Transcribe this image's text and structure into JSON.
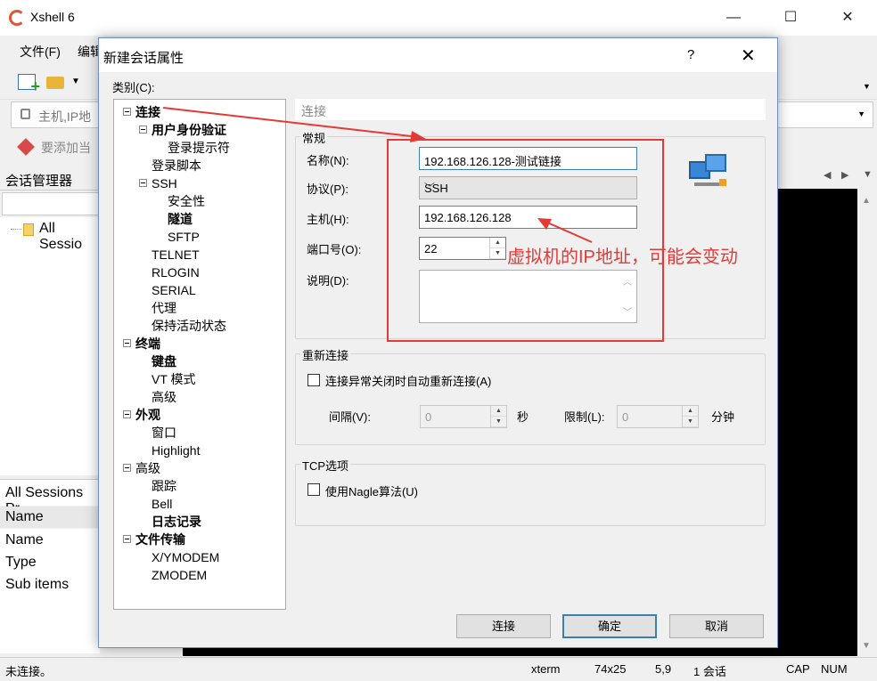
{
  "main_window": {
    "title": "Xshell 6",
    "controls": {
      "minimize": "—",
      "maximize": "☐",
      "close": "✕"
    },
    "menu": [
      "文件(F)",
      "编辑"
    ],
    "address_placeholder": "主机,IP地",
    "bookmark_text": "要添加当",
    "session_manager_title": "会话管理器",
    "session_tree_item": "All Sessio",
    "properties_header": "All Sessions Pr",
    "properties_column": "Name",
    "properties_rows": [
      "Name",
      "Type",
      "Sub items"
    ]
  },
  "statusbar": {
    "left": "未连接。",
    "term": "xterm",
    "size": "74x25",
    "cursor": "5,9",
    "sessions": "1 会话",
    "cap": "CAP",
    "num": "NUM"
  },
  "dialog": {
    "title": "新建会话属性",
    "help": "?",
    "close": "✕",
    "category_label": "类别(C):",
    "tree": [
      {
        "label": "连接",
        "level": 0,
        "bold": true,
        "expand": true
      },
      {
        "label": "用户身份验证",
        "level": 1,
        "bold": true,
        "expand": true
      },
      {
        "label": "登录提示符",
        "level": 2,
        "bold": false,
        "expand": false
      },
      {
        "label": "登录脚本",
        "level": 1,
        "bold": false,
        "expand": false
      },
      {
        "label": "SSH",
        "level": 1,
        "bold": false,
        "expand": true
      },
      {
        "label": "安全性",
        "level": 2,
        "bold": false,
        "expand": false
      },
      {
        "label": "隧道",
        "level": 2,
        "bold": true,
        "expand": false
      },
      {
        "label": "SFTP",
        "level": 2,
        "bold": false,
        "expand": false
      },
      {
        "label": "TELNET",
        "level": 1,
        "bold": false,
        "expand": false
      },
      {
        "label": "RLOGIN",
        "level": 1,
        "bold": false,
        "expand": false
      },
      {
        "label": "SERIAL",
        "level": 1,
        "bold": false,
        "expand": false
      },
      {
        "label": "代理",
        "level": 1,
        "bold": false,
        "expand": false
      },
      {
        "label": "保持活动状态",
        "level": 1,
        "bold": false,
        "expand": false
      },
      {
        "label": "终端",
        "level": 0,
        "bold": true,
        "expand": true
      },
      {
        "label": "键盘",
        "level": 1,
        "bold": true,
        "expand": false
      },
      {
        "label": "VT 模式",
        "level": 1,
        "bold": false,
        "expand": false
      },
      {
        "label": "高级",
        "level": 1,
        "bold": false,
        "expand": false
      },
      {
        "label": "外观",
        "level": 0,
        "bold": true,
        "expand": true
      },
      {
        "label": "窗口",
        "level": 1,
        "bold": false,
        "expand": false
      },
      {
        "label": "Highlight",
        "level": 1,
        "bold": false,
        "expand": false
      },
      {
        "label": "高级",
        "level": 0,
        "bold": false,
        "expand": true
      },
      {
        "label": "跟踪",
        "level": 1,
        "bold": false,
        "expand": false
      },
      {
        "label": "Bell",
        "level": 1,
        "bold": false,
        "expand": false
      },
      {
        "label": "日志记录",
        "level": 1,
        "bold": true,
        "expand": false
      },
      {
        "label": "文件传输",
        "level": 0,
        "bold": true,
        "expand": true
      },
      {
        "label": "X/YMODEM",
        "level": 1,
        "bold": false,
        "expand": false
      },
      {
        "label": "ZMODEM",
        "level": 1,
        "bold": false,
        "expand": false
      }
    ],
    "section_header": "连接",
    "general": {
      "title": "常规",
      "name_label": "名称(N):",
      "name_value": "192.168.126.128-测试链接",
      "protocol_label": "协议(P):",
      "protocol_value": "SSH",
      "host_label": "主机(H):",
      "host_value": "192.168.126.128",
      "port_label": "端口号(O):",
      "port_value": "22",
      "desc_label": "说明(D):",
      "desc_value": ""
    },
    "reconnect": {
      "title": "重新连接",
      "checkbox_label": "连接异常关闭时自动重新连接(A)",
      "checked": false,
      "interval_label": "间隔(V):",
      "interval_value": "0",
      "interval_unit": "秒",
      "limit_label": "限制(L):",
      "limit_value": "0",
      "limit_unit": "分钟"
    },
    "tcp": {
      "title": "TCP选项",
      "checkbox_label": "使用Nagle算法(U)",
      "checked": false
    },
    "buttons": {
      "connect": "连接",
      "ok": "确定",
      "cancel": "取消"
    }
  },
  "annotation": {
    "text": "虚拟机的IP地址，可能会变动",
    "color": "#e53935"
  }
}
